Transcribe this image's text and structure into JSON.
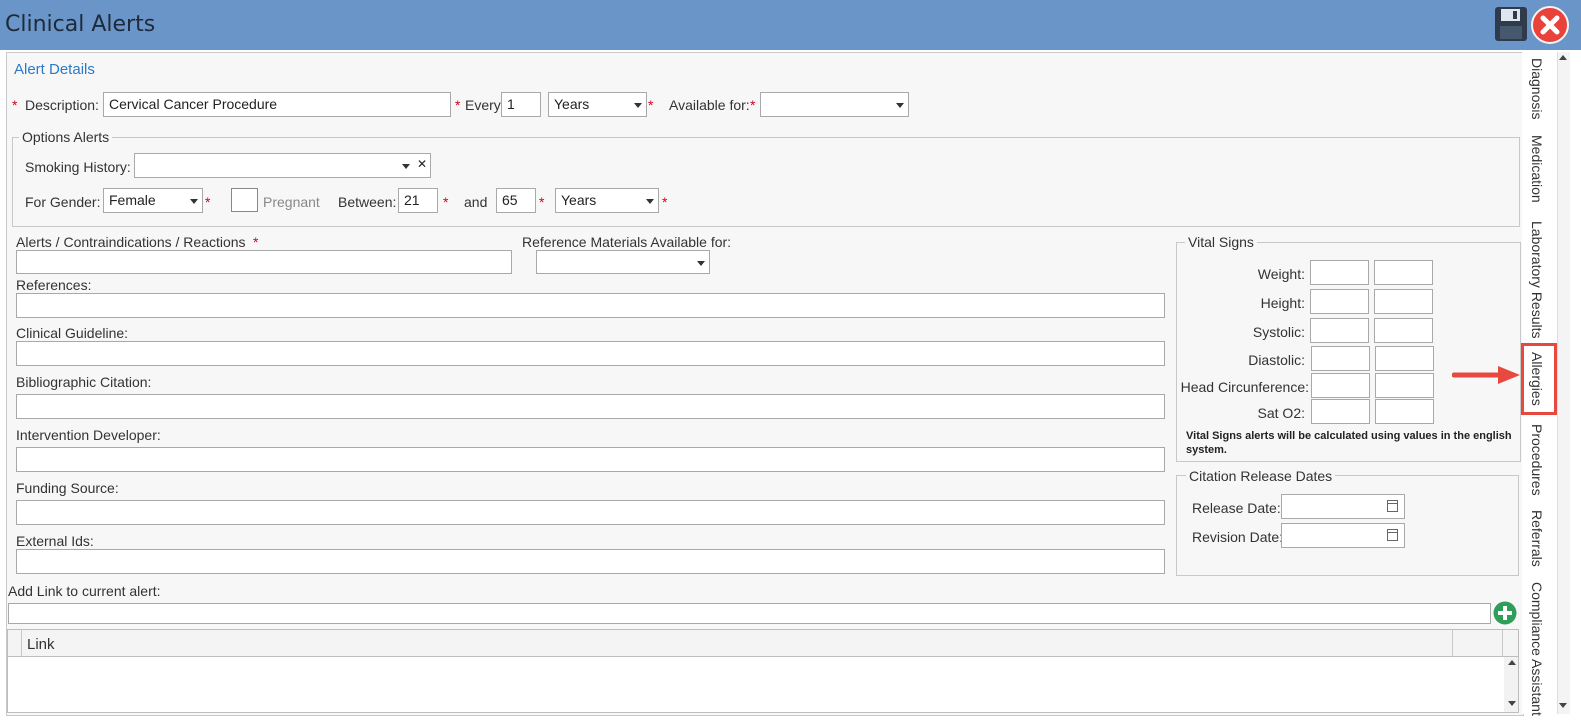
{
  "window": {
    "title": "Clinical Alerts"
  },
  "toolbar": {
    "save_icon": "floppy-disk-icon",
    "close_icon": "close-circle-icon",
    "close_color": "#e8423a"
  },
  "alert_details": {
    "header": "Alert Details",
    "description_label": "Description:",
    "description_value": "Cervical Cancer Procedure",
    "every_label": "Every:",
    "every_value": "1",
    "every_unit": "Years",
    "available_for_label": "Available for:",
    "available_for_value": ""
  },
  "options_alerts": {
    "legend": "Options Alerts",
    "smoking_label": "Smoking History:",
    "smoking_value": "",
    "smoking_clear": "✕",
    "gender_label": "For Gender:",
    "gender_value": "Female",
    "pregnant_label": "Pregnant",
    "between_label": "Between:",
    "age_from": "21",
    "and_label": "and",
    "age_to": "65",
    "age_unit": "Years"
  },
  "fields": {
    "alerts_label": "Alerts / Contraindications / Reactions",
    "ref_materials_label": "Reference Materials Available for:",
    "references_label": "References:",
    "clinical_guideline_label": "Clinical Guideline:",
    "bibliographic_label": "Bibliographic Citation:",
    "intervention_label": "Intervention Developer:",
    "funding_label": "Funding Source:",
    "external_ids_label": "External Ids:",
    "add_link_label": "Add Link to current alert:"
  },
  "vital_signs": {
    "legend": "Vital Signs",
    "rows": [
      "Weight:",
      "Height:",
      "Systolic:",
      "Diastolic:",
      "Head Circunference:",
      "Sat O2:"
    ],
    "note": "Vital Signs alerts will be calculated using values in the english system."
  },
  "citation": {
    "legend": "Citation Release Dates",
    "release_label": "Release Date:",
    "revision_label": "Revision Date:"
  },
  "links_table": {
    "column": "Link"
  },
  "side_tabs": [
    "Diagnosis",
    "Medication",
    "Laboratory Results",
    "Allergies",
    "Procedures",
    "Referrals",
    "Compliance Assistant"
  ],
  "highlight_color": "#e8493f",
  "add_button_color": "#2e9e5b"
}
